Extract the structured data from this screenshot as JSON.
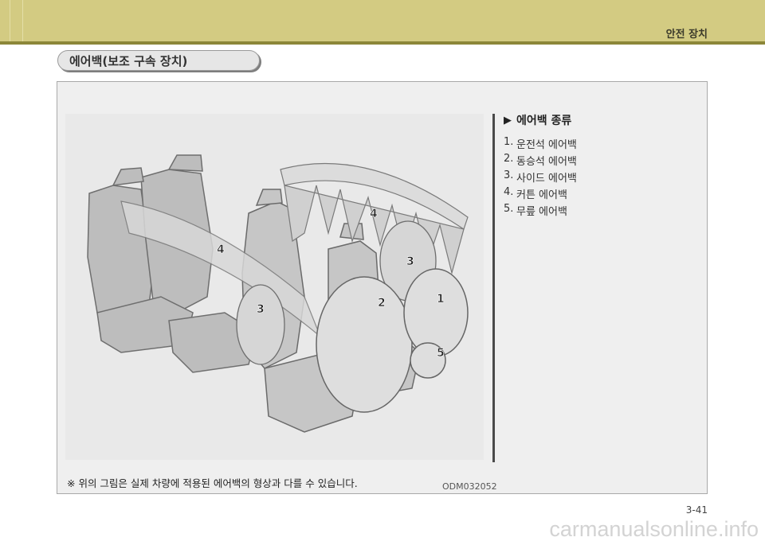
{
  "header": {
    "chapter": "안전 장치"
  },
  "section": {
    "title": "에어백(보조 구속 장치)"
  },
  "figure": {
    "image_code": "ODM032052",
    "callouts": [
      "4",
      "4",
      "3",
      "3",
      "2",
      "1",
      "5"
    ]
  },
  "legend": {
    "title": "에어백 종류",
    "items": [
      {
        "num": "1.",
        "label": "운전석 에어백"
      },
      {
        "num": "2.",
        "label": "동승석 에어백"
      },
      {
        "num": "3.",
        "label": "사이드 에어백"
      },
      {
        "num": "4.",
        "label": "커튼 에어백"
      },
      {
        "num": "5.",
        "label": "무릎 에어백"
      }
    ]
  },
  "note": "※ 위의 그림은 실제 차량에 적용된 에어백의 형상과 다를 수 있습니다.",
  "footer": {
    "page": "3-41",
    "brand": "carmanualsonline.info"
  }
}
